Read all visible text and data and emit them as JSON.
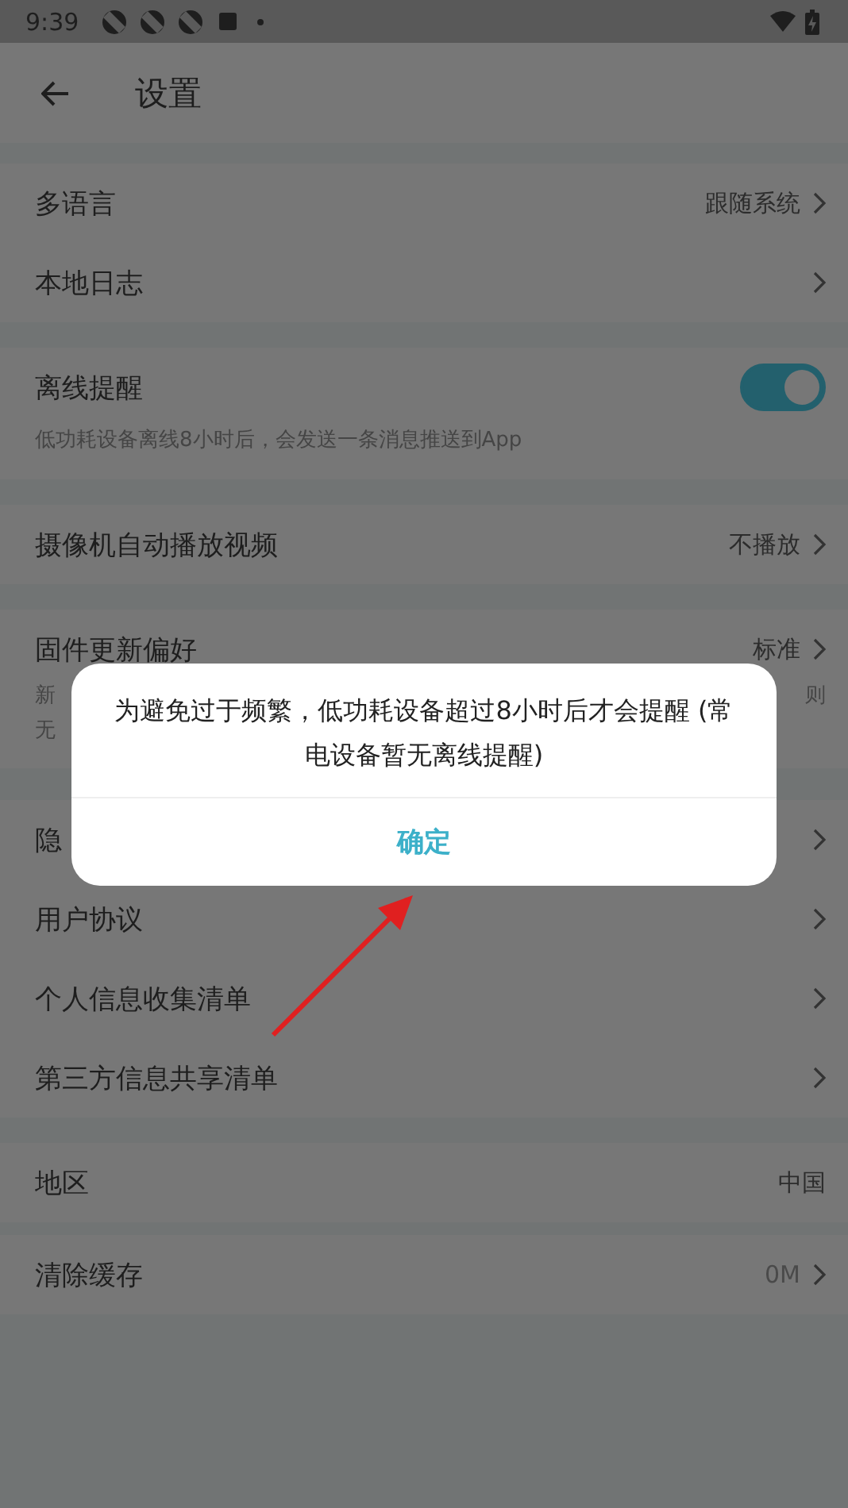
{
  "status_bar": {
    "time": "9:39"
  },
  "header": {
    "title": "设置"
  },
  "sections": [
    {
      "items": [
        {
          "kind": "link",
          "label": "多语言",
          "value": "跟随系统",
          "chevron": true
        },
        {
          "kind": "link",
          "label": "本地日志",
          "chevron": true
        }
      ]
    },
    {
      "items": [
        {
          "kind": "toggle",
          "label": "离线提醒",
          "on": true,
          "description": "低功耗设备离线8小时后，会发送一条消息推送到App"
        }
      ]
    },
    {
      "items": [
        {
          "kind": "link",
          "label": "摄像机自动播放视频",
          "value": "不播放",
          "chevron": true
        }
      ]
    },
    {
      "items": [
        {
          "kind": "link",
          "label": "固件更新偏好",
          "value": "标准",
          "chevron": true,
          "description_left": [
            "新",
            "无"
          ],
          "description_right": [
            "则"
          ]
        }
      ]
    },
    {
      "items": [
        {
          "kind": "link",
          "label": "隐",
          "chevron": true
        },
        {
          "kind": "link",
          "label": "用户协议",
          "chevron": true
        },
        {
          "kind": "link",
          "label": "个人信息收集清单",
          "chevron": true
        },
        {
          "kind": "link",
          "label": "第三方信息共享清单",
          "chevron": true
        }
      ]
    },
    {
      "items": [
        {
          "kind": "link",
          "label": "地区",
          "value": "中国",
          "chevron": false
        }
      ]
    },
    {
      "items": [
        {
          "kind": "link",
          "label": "清除缓存",
          "value": "0M",
          "faded": true,
          "chevron": true
        }
      ]
    }
  ],
  "dialog": {
    "message": "为避免过于频繁，低功耗设备超过8小时后才会提醒 (常电设备暂无离线提醒)",
    "button": "确定"
  }
}
